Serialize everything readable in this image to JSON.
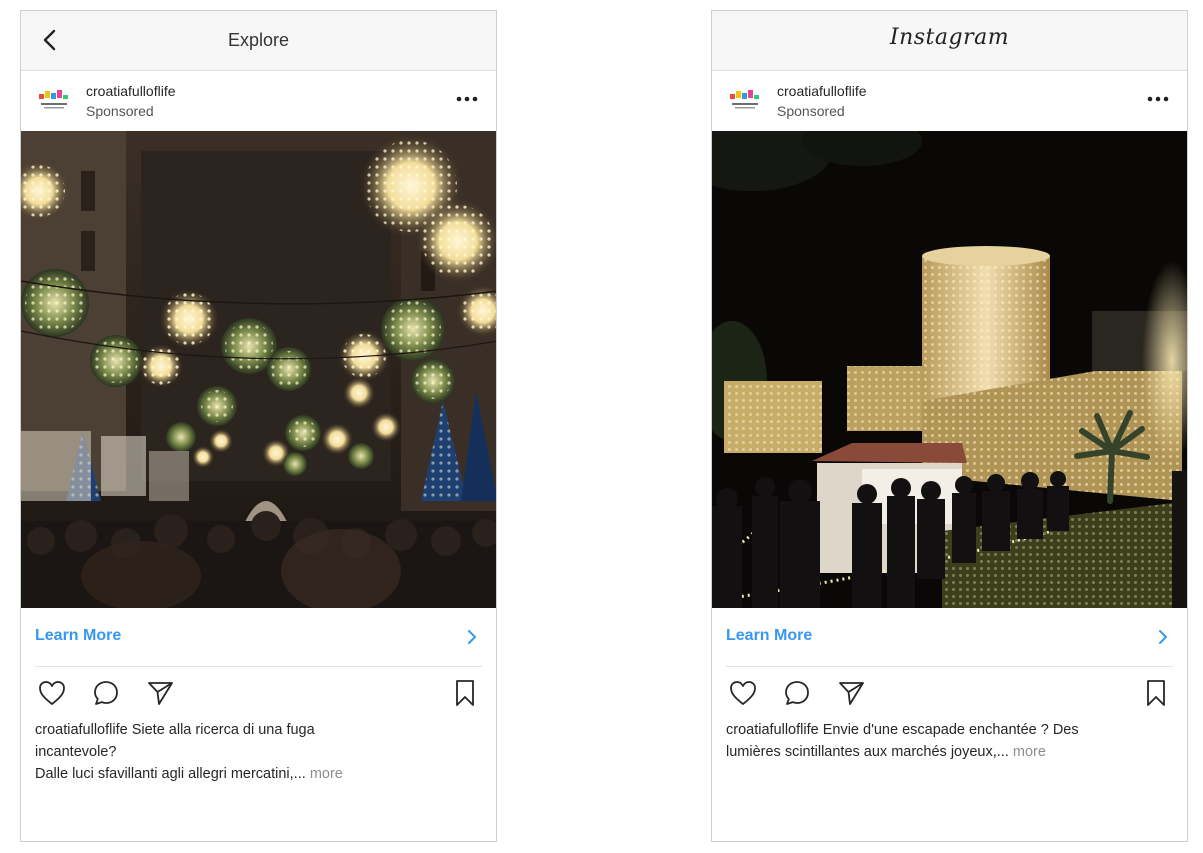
{
  "left_post": {
    "header_title": "Explore",
    "account": "croatiafulloflife",
    "sponsored": "Sponsored",
    "cta_label": "Learn More",
    "caption_user": "croatiafulloflife",
    "caption_line1": "Siete alla ricerca di una fuga",
    "caption_line2": "incantevole?",
    "caption_line3": "Dalle luci sfavillanti agli allegri mercatini,...",
    "more_label": "more",
    "icons": [
      "back-chevron-icon",
      "more-options-icon",
      "heart-icon",
      "comment-icon",
      "share-icon",
      "bookmark-icon",
      "chevron-right-icon"
    ]
  },
  "right_post": {
    "header_brand": "Instagram",
    "account": "croatiafulloflife",
    "sponsored": "Sponsored",
    "cta_label": "Learn More",
    "caption_user": "croatiafulloflife",
    "caption_line1": "Envie d'une escapade enchantée ? Des",
    "caption_line2": "lumières scintillantes aux marchés joyeux,...",
    "more_label": "more",
    "icons": [
      "more-options-icon",
      "heart-icon",
      "comment-icon",
      "share-icon",
      "bookmark-icon",
      "chevron-right-icon"
    ]
  },
  "colors": {
    "link_blue": "#3897f0",
    "more_gray": "#8e8e8e",
    "header_bg": "#f7f7f7"
  }
}
